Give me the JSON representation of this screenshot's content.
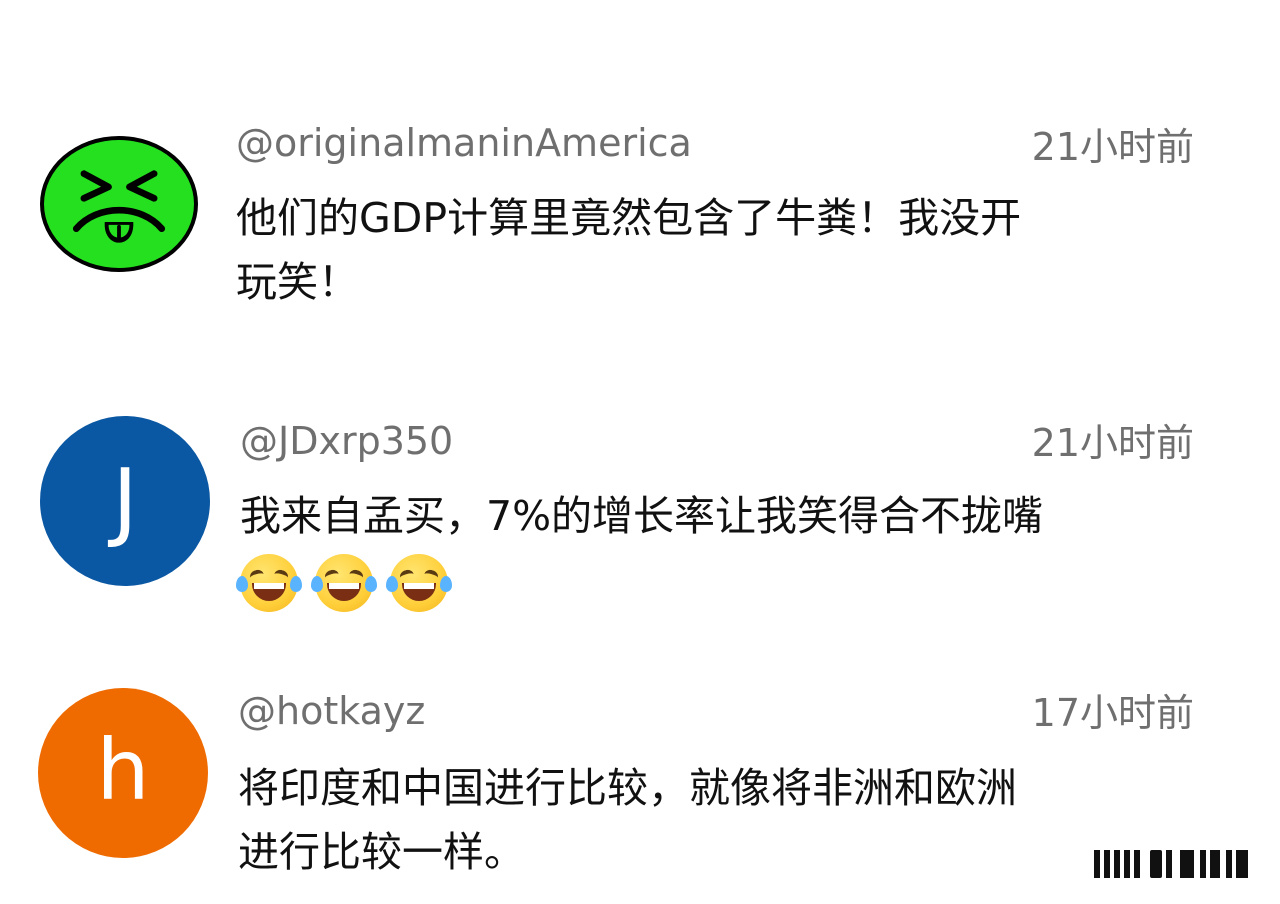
{
  "comments": [
    {
      "username": "@originalmaninAmerica",
      "timestamp": "21小时前",
      "lines": [
        "他们的GDP计算里竟然包含了牛粪！我没开",
        "玩笑！"
      ],
      "avatar": {
        "type": "yuck-face",
        "color": "#24e01f"
      }
    },
    {
      "username": "@JDxrp350",
      "timestamp": "21小时前",
      "lines": [
        "我来自孟买，7%的增长率让我笑得合不拢嘴",
        ""
      ],
      "emojis": [
        "face-with-tears-of-joy",
        "face-with-tears-of-joy",
        "face-with-tears-of-joy"
      ],
      "avatar": {
        "type": "letter",
        "letter": "J",
        "color": "#0a58a3"
      }
    },
    {
      "username": "@hotkayz",
      "timestamp": "17小时前",
      "lines": [
        "将印度和中国进行比较，就像将非洲和欧洲",
        "进行比较一样。"
      ],
      "avatar": {
        "type": "letter",
        "letter": "h",
        "color": "#ef6b00"
      }
    }
  ],
  "watermark": {
    "type": "barcode-watermark"
  }
}
